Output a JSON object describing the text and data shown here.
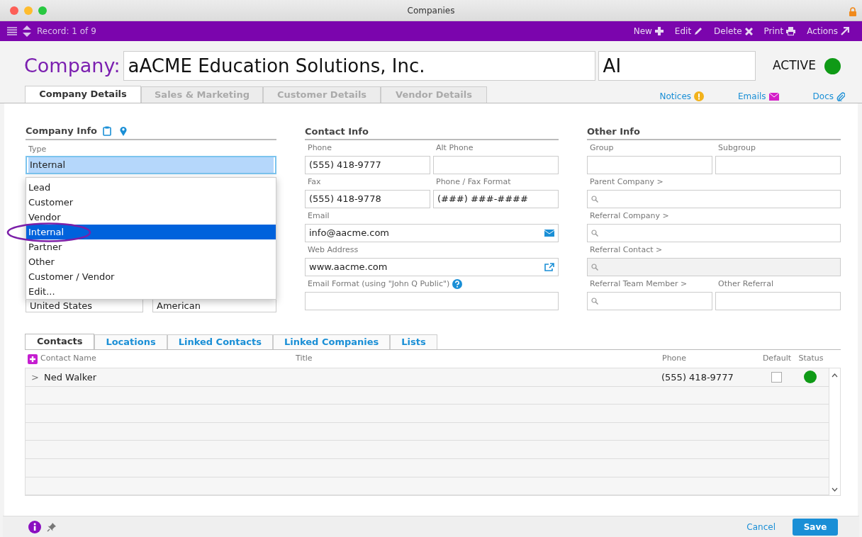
{
  "window": {
    "title": "Companies"
  },
  "toolbar": {
    "record": "Record: 1 of 9",
    "actions": [
      {
        "label": "New"
      },
      {
        "label": "Edit"
      },
      {
        "label": "Delete"
      },
      {
        "label": "Print"
      },
      {
        "label": "Actions"
      }
    ]
  },
  "header": {
    "label": "Company:",
    "name": "aACME Education Solutions, Inc.",
    "abbreviation": "AI",
    "status": "ACTIVE",
    "active": true
  },
  "tabs": [
    {
      "label": "Company Details",
      "selected": true
    },
    {
      "label": "Sales & Marketing",
      "selected": false
    },
    {
      "label": "Customer Details",
      "selected": false
    },
    {
      "label": "Vendor Details",
      "selected": false
    }
  ],
  "links": [
    {
      "label": "Notices"
    },
    {
      "label": "Emails"
    },
    {
      "label": "Docs"
    }
  ],
  "company_info": {
    "title": "Company Info",
    "type_field": {
      "label": "Type",
      "value": "Internal"
    },
    "dropdown": [
      {
        "label": "Lead",
        "selected": false
      },
      {
        "label": "Customer",
        "selected": false
      },
      {
        "label": "Vendor",
        "selected": false
      },
      {
        "label": "Internal",
        "selected": true
      },
      {
        "label": "Partner",
        "selected": false
      },
      {
        "label": "Other",
        "selected": false
      },
      {
        "label": "Customer / Vendor",
        "selected": false
      },
      {
        "label": "Edit...",
        "selected": false
      }
    ],
    "covered_fields": [
      {
        "value": "United States"
      },
      {
        "value": "American"
      }
    ]
  },
  "contact_info": {
    "title": "Contact Info",
    "rows": [
      [
        {
          "kind": "text",
          "label": "Phone",
          "value": "(555) 418-9777",
          "disabled": false
        },
        {
          "kind": "text",
          "label": "Alt Phone",
          "disabled": false
        }
      ],
      [
        {
          "kind": "text",
          "label": "Fax",
          "value": "(555) 418-9778",
          "disabled": false
        },
        {
          "kind": "text",
          "label": "Phone / Fax Format",
          "value": "(###) ###-####",
          "disabled": false
        }
      ],
      [
        {
          "kind": "email",
          "label": "Email",
          "value": "info@aacme.com",
          "disabled": false
        }
      ],
      [
        {
          "kind": "url",
          "label": "Web Address",
          "value": "www.aacme.com",
          "disabled": false
        }
      ],
      [
        {
          "kind": "text",
          "label": "Email Format (using \"John Q Public\")",
          "help": true,
          "disabled": false
        }
      ]
    ]
  },
  "other_info": {
    "title": "Other Info",
    "rows": [
      [
        {
          "kind": "text",
          "label": "Group",
          "disabled": false
        },
        {
          "kind": "text",
          "label": "Subgroup",
          "disabled": false
        }
      ],
      [
        {
          "kind": "lookup",
          "label": "Parent Company >",
          "disabled": false
        }
      ],
      [
        {
          "kind": "lookup",
          "label": "Referral Company >",
          "disabled": false
        }
      ],
      [
        {
          "kind": "lookup",
          "label": "Referral Contact >",
          "disabled": true
        }
      ],
      [
        {
          "kind": "lookup",
          "label": "Referral Team Member >",
          "disabled": false
        },
        {
          "kind": "text",
          "label": "Other Referral",
          "disabled": false
        }
      ]
    ]
  },
  "contacts": {
    "tabs": [
      {
        "label": "Contacts",
        "selected": true
      },
      {
        "label": "Locations",
        "selected": false
      },
      {
        "label": "Linked Contacts",
        "selected": false
      },
      {
        "label": "Linked Companies",
        "selected": false
      },
      {
        "label": "Lists",
        "selected": false
      }
    ],
    "columns": [
      "Contact Name",
      "Title",
      "Phone",
      "Default",
      "Status"
    ],
    "rows": [
      {
        "expander": ">",
        "name": "Ned Walker",
        "phone": "(555) 418-9777",
        "default": false,
        "active": true
      }
    ]
  },
  "footer": {
    "cancel": "Cancel",
    "save": "Save"
  }
}
